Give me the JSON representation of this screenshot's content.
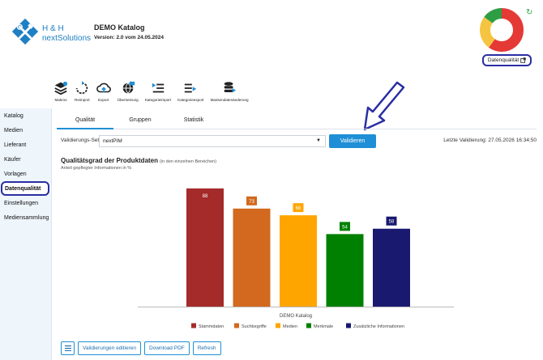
{
  "header": {
    "brand_line1": "H & H",
    "brand_line2": "nextSolutions",
    "title": "DEMO Katalog",
    "version": "Version: 2.0 vom 24.05.2024",
    "quality_link": "Datenqualität"
  },
  "toolbar": [
    {
      "label": "Makros",
      "icon": "stack-icon"
    },
    {
      "label": "Reimport",
      "icon": "refresh-circle-icon"
    },
    {
      "label": "Export",
      "icon": "cloud-upload-icon"
    },
    {
      "label": "Übersetzung",
      "icon": "globe-icon"
    },
    {
      "label": "Kategorieimport",
      "icon": "list-import-icon"
    },
    {
      "label": "Kategorieexport",
      "icon": "list-export-icon"
    },
    {
      "label": "Massendatenänderung",
      "icon": "database-icon"
    }
  ],
  "sidebar": {
    "items": [
      {
        "label": "Katalog"
      },
      {
        "label": "Medien"
      },
      {
        "label": "Lieferant"
      },
      {
        "label": "Käufer"
      },
      {
        "label": "Vorlagen"
      },
      {
        "label": "Datenqualität"
      },
      {
        "label": "Einstellungen"
      },
      {
        "label": "Mediensammlung"
      }
    ],
    "active_index": 5
  },
  "tabs": [
    {
      "label": "Qualität"
    },
    {
      "label": "Gruppen"
    },
    {
      "label": "Statistik"
    }
  ],
  "validation": {
    "label": "Validierungs-Set",
    "selected": "nextPIM",
    "button": "Validieren",
    "last": "Letzte Validierung: 27.05.2026 16:34:50"
  },
  "chart_data": {
    "type": "bar",
    "title": "Qualitätsgrad der Produktdaten",
    "title_note": "(in den einzelnen Bereichen)",
    "subtitle": "Anteil gepflegter Informationen in %",
    "category": "DEMO Katalog",
    "ylim": [
      0,
      100
    ],
    "grid": false,
    "legend_position": "bottom",
    "series": [
      {
        "name": "Stammdaten",
        "value": 88,
        "color": "#a52a2a"
      },
      {
        "name": "Suchbegriffe",
        "value": 73,
        "color": "#d2691e"
      },
      {
        "name": "Medien",
        "value": 68,
        "color": "#ffa500"
      },
      {
        "name": "Merkmale",
        "value": 54,
        "color": "#008000"
      },
      {
        "name": "Zusätzliche Informationen",
        "value": 58,
        "color": "#191970"
      }
    ]
  },
  "donut": {
    "segments": [
      {
        "value": 60,
        "color": "#e53935"
      },
      {
        "value": 25,
        "color": "#f5c542"
      },
      {
        "value": 15,
        "color": "#2e9e44"
      }
    ]
  },
  "bottom_buttons": {
    "edit": "Validierungen editieren",
    "pdf": "Download PDF",
    "refresh": "Refresh"
  },
  "colors": {
    "accent": "#1e8fd6",
    "highlight": "#2a2ea3"
  }
}
